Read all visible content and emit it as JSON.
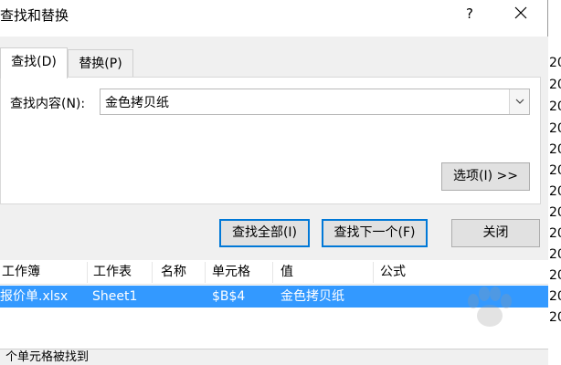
{
  "dialog": {
    "title": "查找和替换",
    "help": "?"
  },
  "tabs": [
    {
      "label": "查找(D)",
      "active": true
    },
    {
      "label": "替换(P)",
      "active": false
    }
  ],
  "find": {
    "label": "查找内容(N):",
    "value": "金色拷贝纸"
  },
  "buttons": {
    "options": "选项(I) >>",
    "find_all": "查找全部(I)",
    "find_next": "查找下一个(F)",
    "close": "关闭"
  },
  "results": {
    "columns": [
      "工作簿",
      "工作表",
      "名称",
      "单元格",
      "值",
      "公式"
    ],
    "rows": [
      {
        "workbook": "报价单.xlsx",
        "sheet": "Sheet1",
        "name": "",
        "cell": "$B$4",
        "value": "金色拷贝纸",
        "formula": ""
      }
    ]
  },
  "status": "个单元格被找到",
  "background_sheet": {
    "numbers": [
      "20",
      "20",
      "20",
      "20",
      "20",
      "20",
      "20",
      "20",
      "20",
      "20",
      "20",
      "20",
      "20"
    ]
  },
  "colors": {
    "selection": "#3399ff",
    "accent": "#0078d7",
    "dialog_bg": "#f0f0f0"
  }
}
